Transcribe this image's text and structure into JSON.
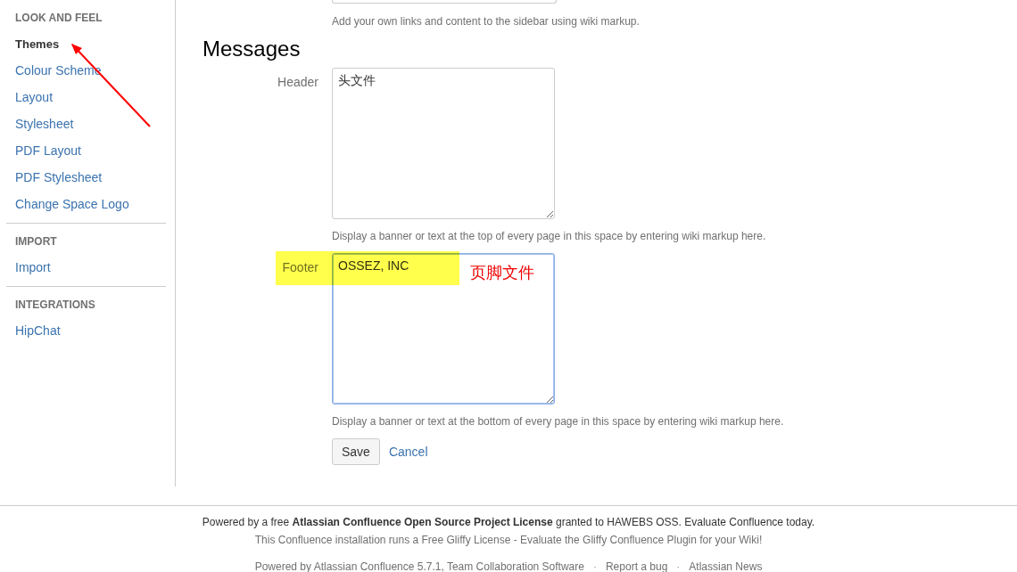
{
  "sidebar": {
    "sections": [
      {
        "heading": "LOOK AND FEEL",
        "items": [
          {
            "label": "Themes",
            "selected": true
          },
          {
            "label": "Colour Scheme",
            "selected": false
          },
          {
            "label": "Layout",
            "selected": false
          },
          {
            "label": "Stylesheet",
            "selected": false
          },
          {
            "label": "PDF Layout",
            "selected": false
          },
          {
            "label": "PDF Stylesheet",
            "selected": false
          },
          {
            "label": "Change Space Logo",
            "selected": false
          }
        ]
      },
      {
        "heading": "IMPORT",
        "items": [
          {
            "label": "Import",
            "selected": false
          }
        ]
      },
      {
        "heading": "INTEGRATIONS",
        "items": [
          {
            "label": "HipChat",
            "selected": false
          }
        ]
      }
    ]
  },
  "content": {
    "sidebar_hint": "Add your own links and content to the sidebar using wiki markup.",
    "title": "Messages",
    "fields": [
      {
        "label": "Header",
        "value": "头文件",
        "hint": "Display a banner or text at the top of every page in this space by entering wiki markup here.",
        "focused": false
      },
      {
        "label": "Footer",
        "value": "OSSEZ, INC",
        "hint": "Display a banner or text at the bottom of every page in this space by entering wiki markup here.",
        "focused": true
      }
    ],
    "save": "Save",
    "cancel": "Cancel"
  },
  "annotations": {
    "note": "页脚文件",
    "highlight": true,
    "arrow": true
  },
  "footer": {
    "license": "Powered by a free **Atlassian Confluence Open Source Project License** granted to HAWEBS OSS. Evaluate Confluence today.",
    "gliffy": "This Confluence installation runs a Free Gliffy License - Evaluate the Gliffy Confluence Plugin for your Wiki!",
    "links": [
      {
        "kind": "link",
        "text": "Powered by Atlassian Confluence 5.7.1, Team Collaboration Software"
      },
      {
        "kind": "separator",
        "text": "·"
      },
      {
        "kind": "link",
        "text": "Report a bug"
      },
      {
        "kind": "separator",
        "text": "·"
      },
      {
        "kind": "link",
        "text": "Atlassian News"
      }
    ]
  }
}
